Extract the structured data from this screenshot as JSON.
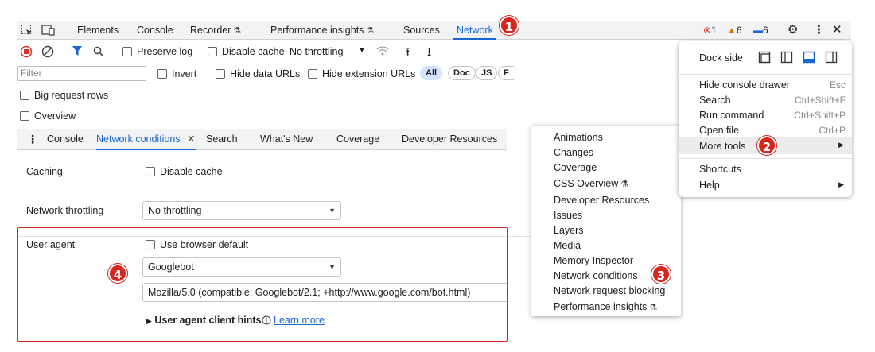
{
  "topbar": {
    "tabs": [
      "Elements",
      "Console",
      "Recorder",
      "Performance insights",
      "Sources",
      "Network"
    ],
    "errors": "1",
    "warnings": "6",
    "messages": "6"
  },
  "toolbar": {
    "preserve_log": "Preserve log",
    "disable_cache": "Disable cache",
    "throttling": "No throttling"
  },
  "filterbar": {
    "placeholder": "Filter",
    "invert": "Invert",
    "hide_data_urls": "Hide data URLs",
    "hide_extension_urls": "Hide extension URLs",
    "pills": [
      "All",
      "Doc",
      "JS",
      "F"
    ]
  },
  "options": {
    "big_request_rows": "Big request rows",
    "overview": "Overview"
  },
  "drawer": {
    "tabs": [
      "Console",
      "Network conditions",
      "Search",
      "What's New",
      "Coverage",
      "Developer Resources"
    ]
  },
  "conditions": {
    "caching_label": "Caching",
    "disable_cache": "Disable cache",
    "throttling_label": "Network throttling",
    "throttling_value": "No throttling",
    "user_agent_label": "User agent",
    "use_browser_default": "Use browser default",
    "ua_select": "Googlebot",
    "ua_string": "Mozilla/5.0 (compatible; Googlebot/2.1; +http://www.google.com/bot.html)",
    "client_hints": "User agent client hints",
    "learn_more": "Learn more"
  },
  "menu": {
    "dock_side": "Dock side",
    "items": [
      {
        "label": "Hide console drawer",
        "shortcut": "Esc"
      },
      {
        "label": "Search",
        "shortcut": "Ctrl+Shift+F"
      },
      {
        "label": "Run command",
        "shortcut": "Ctrl+Shift+P"
      },
      {
        "label": "Open file",
        "shortcut": "Ctrl+P"
      },
      {
        "label": "More tools",
        "shortcut": ""
      },
      {
        "label": "Shortcuts",
        "shortcut": ""
      },
      {
        "label": "Help",
        "shortcut": ""
      }
    ]
  },
  "submenu": {
    "items": [
      "Animations",
      "Changes",
      "Coverage",
      "CSS Overview",
      "Developer Resources",
      "Issues",
      "Layers",
      "Media",
      "Memory Inspector",
      "Network conditions",
      "Network request blocking",
      "Performance insights"
    ]
  },
  "badges": [
    "1",
    "2",
    "3",
    "4"
  ],
  "colors": {
    "accent": "#1a66d2",
    "badge": "#d8261f",
    "tabbar": "#f1f3f4"
  }
}
